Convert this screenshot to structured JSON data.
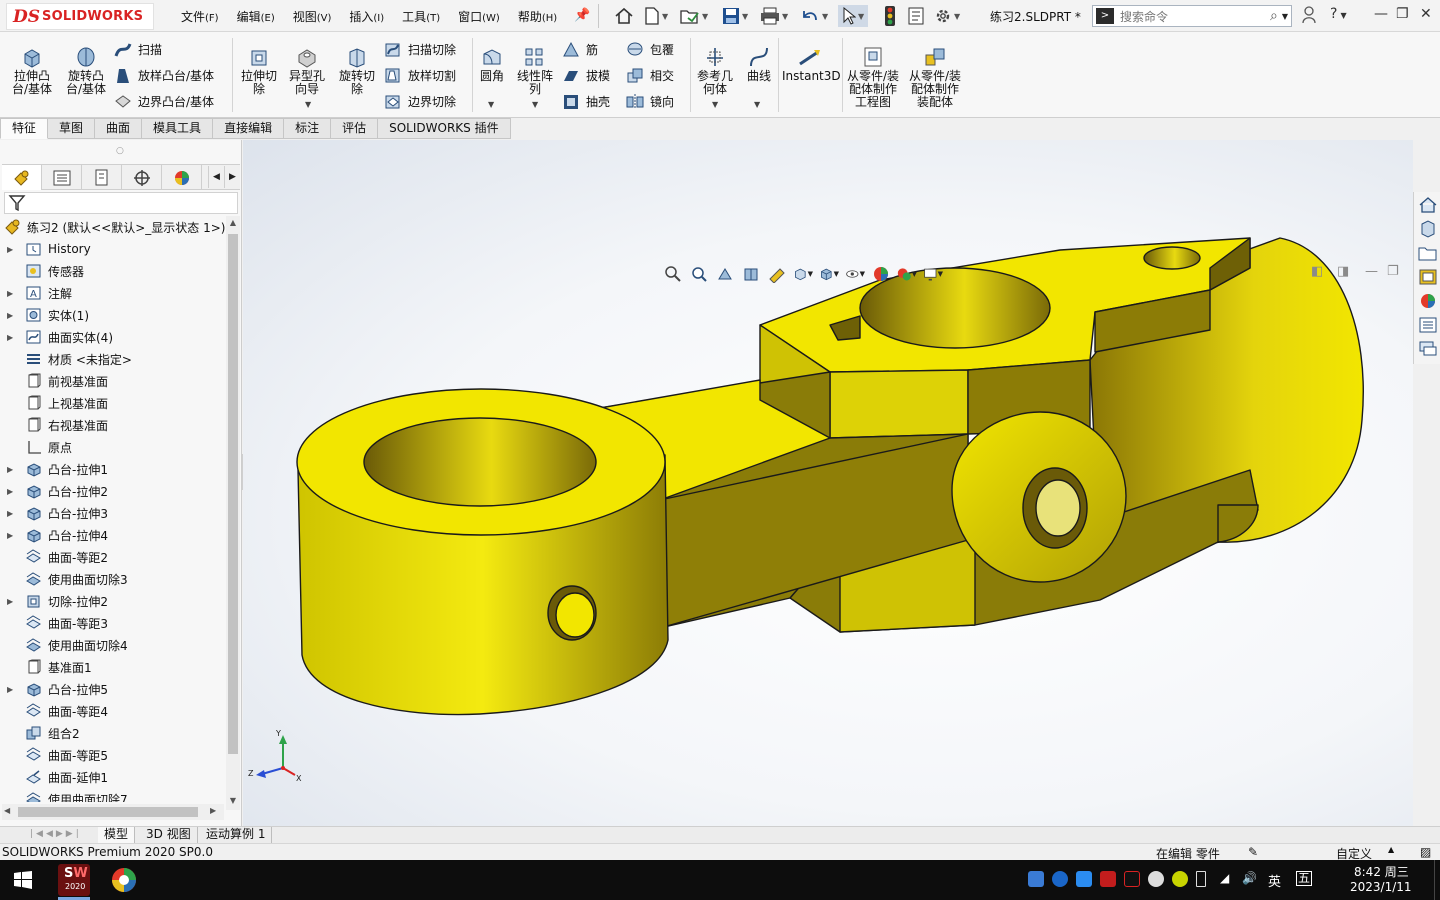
{
  "app": {
    "logo_ds": "DS",
    "logo_sw": "SOLIDWORKS",
    "doc_title": "练习2.SLDPRT *",
    "search_placeholder": "搜索命令"
  },
  "menu": [
    {
      "label": "文件",
      "key": "(F)"
    },
    {
      "label": "编辑",
      "key": "(E)"
    },
    {
      "label": "视图",
      "key": "(V)"
    },
    {
      "label": "插入",
      "key": "(I)"
    },
    {
      "label": "工具",
      "key": "(T)"
    },
    {
      "label": "窗口",
      "key": "(W)"
    },
    {
      "label": "帮助",
      "key": "(H)"
    }
  ],
  "ribbon": {
    "extrude_boss": "拉伸凸台/基体",
    "revolve_boss": "旋转凸台/基体",
    "sweep": "扫描",
    "loft": "放样凸台/基体",
    "boundary": "边界凸台/基体",
    "extrude_cut": "拉伸切除",
    "hole_wizard": "异型孔向导",
    "revolve_cut": "旋转切除",
    "swept_cut": "扫描切除",
    "lofted_cut": "放样切割",
    "boundary_cut": "边界切除",
    "fillet": "圆角",
    "linear_pattern": "线性阵列",
    "rib": "筋",
    "draft": "拔模",
    "shell": "抽壳",
    "wrap": "包覆",
    "intersect": "相交",
    "mirror": "镜向",
    "ref_geometry": "参考几何体",
    "curves": "曲线",
    "instant3d": "Instant3D",
    "make_drawing": "从零件/装配体制作工程图",
    "make_assembly": "从零件/装配体制作装配体"
  },
  "tabs": [
    "特征",
    "草图",
    "曲面",
    "模具工具",
    "直接编辑",
    "标注",
    "评估",
    "SOLIDWORKS 插件"
  ],
  "tree": {
    "root": "练习2  (默认<<默认>_显示状态 1>)",
    "items": [
      {
        "label": "History",
        "expand": true,
        "icon": "history-icon"
      },
      {
        "label": "传感器",
        "expand": false,
        "icon": "sensor-icon"
      },
      {
        "label": "注解",
        "expand": true,
        "icon": "annotation-icon"
      },
      {
        "label": "实体(1)",
        "expand": true,
        "icon": "solid-bodies-icon"
      },
      {
        "label": "曲面实体(4)",
        "expand": true,
        "icon": "surface-bodies-icon"
      },
      {
        "label": "材质 <未指定>",
        "expand": false,
        "icon": "material-icon"
      },
      {
        "label": "前视基准面",
        "expand": false,
        "icon": "plane-icon"
      },
      {
        "label": "上视基准面",
        "expand": false,
        "icon": "plane-icon"
      },
      {
        "label": "右视基准面",
        "expand": false,
        "icon": "plane-icon"
      },
      {
        "label": "原点",
        "expand": false,
        "icon": "origin-icon"
      },
      {
        "label": "凸台-拉伸1",
        "expand": true,
        "icon": "boss-extrude-icon"
      },
      {
        "label": "凸台-拉伸2",
        "expand": true,
        "icon": "boss-extrude-icon"
      },
      {
        "label": "凸台-拉伸3",
        "expand": true,
        "icon": "boss-extrude-icon"
      },
      {
        "label": "凸台-拉伸4",
        "expand": true,
        "icon": "boss-extrude-icon"
      },
      {
        "label": "曲面-等距2",
        "expand": false,
        "icon": "offset-surface-icon"
      },
      {
        "label": "使用曲面切除3",
        "expand": false,
        "icon": "surface-cut-icon"
      },
      {
        "label": "切除-拉伸2",
        "expand": true,
        "icon": "cut-extrude-icon"
      },
      {
        "label": "曲面-等距3",
        "expand": false,
        "icon": "offset-surface-icon"
      },
      {
        "label": "使用曲面切除4",
        "expand": false,
        "icon": "surface-cut-icon"
      },
      {
        "label": "基准面1",
        "expand": false,
        "icon": "plane-icon"
      },
      {
        "label": "凸台-拉伸5",
        "expand": true,
        "icon": "boss-extrude-icon"
      },
      {
        "label": "曲面-等距4",
        "expand": false,
        "icon": "offset-surface-icon"
      },
      {
        "label": "组合2",
        "expand": false,
        "icon": "combine-icon"
      },
      {
        "label": "曲面-等距5",
        "expand": false,
        "icon": "offset-surface-icon"
      },
      {
        "label": "曲面-延伸1",
        "expand": false,
        "icon": "extend-surface-icon"
      },
      {
        "label": "使用曲面切除7",
        "expand": false,
        "icon": "surface-cut-icon"
      }
    ]
  },
  "triad": {
    "x": "X",
    "y": "Y",
    "z": "Z"
  },
  "bottom_tabs": [
    "模型",
    "3D 视图",
    "运动算例 1"
  ],
  "status": {
    "product": "SOLIDWORKS Premium 2020 SP0.0",
    "editing": "在编辑 零件",
    "units": "自定义"
  },
  "taskbar": {
    "sw_badge": "2020",
    "ime_lang": "英",
    "ime_mode": "五",
    "time": "8:42 周三",
    "date": "2023/1/11"
  },
  "colors": {
    "model_yellow": "#f2e600",
    "accent_red": "#d92323"
  }
}
